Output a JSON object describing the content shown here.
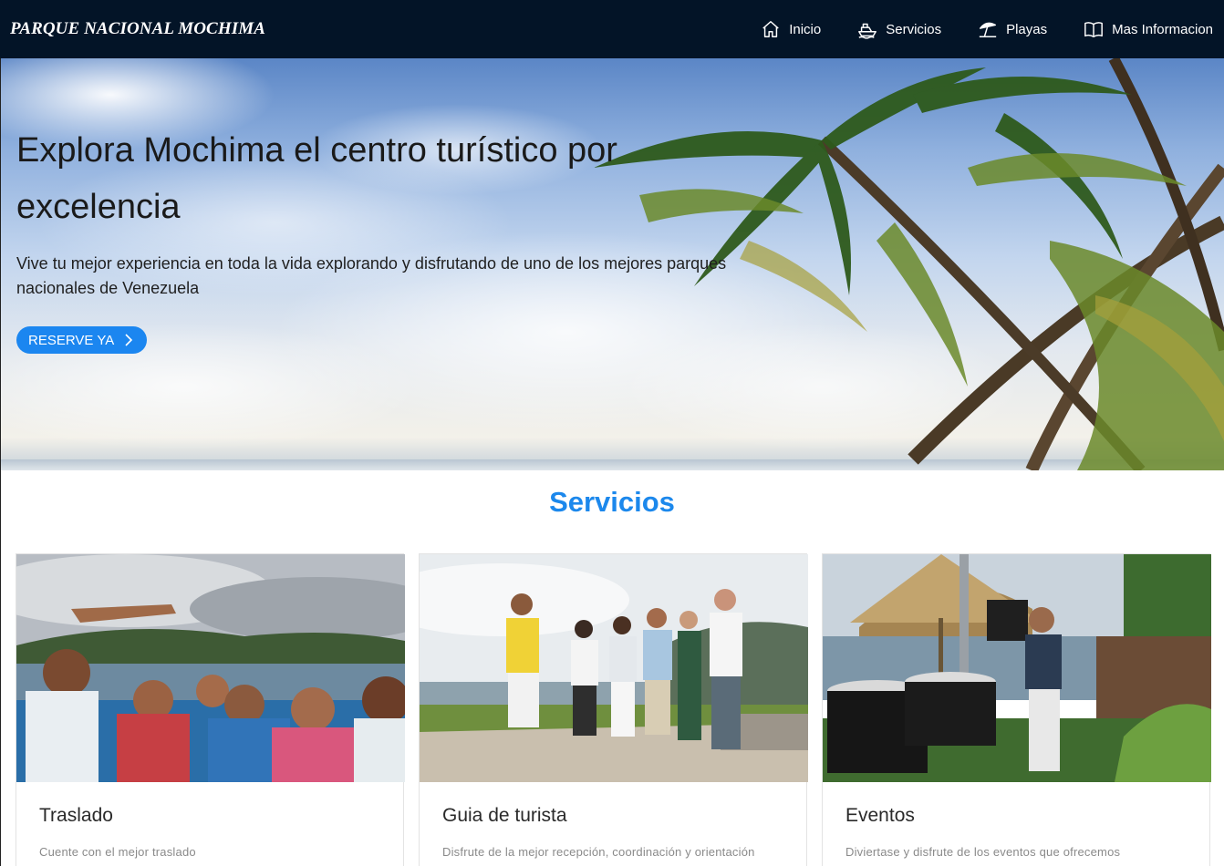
{
  "brand": "PARQUE NACIONAL MOCHIMA",
  "nav": [
    {
      "label": "Inicio",
      "icon": "home-icon"
    },
    {
      "label": "Servicios",
      "icon": "boat-icon"
    },
    {
      "label": "Playas",
      "icon": "beach-umbrella-icon"
    },
    {
      "label": "Mas Informacion",
      "icon": "book-icon"
    }
  ],
  "hero": {
    "title": "Explora Mochima el centro turístico por excelencia",
    "subtitle": "Vive tu mejor experiencia en toda la vida explorando y disfrutando de uno de los mejores parques nacionales de Venezuela",
    "cta": "RESERVE YA"
  },
  "services": {
    "title": "Servicios",
    "cards": [
      {
        "title": "Traslado",
        "desc": "Cuente con el mejor traslado"
      },
      {
        "title": "Guia de turista",
        "desc": "Disfrute de la mejor recepción, coordinación y orientación"
      },
      {
        "title": "Eventos",
        "desc": "Diviertase y disfrute de los eventos que ofrecemos"
      }
    ]
  },
  "colors": {
    "navbar": "#031427",
    "accent": "#1b86f0",
    "services_title": "#1c88ec"
  }
}
